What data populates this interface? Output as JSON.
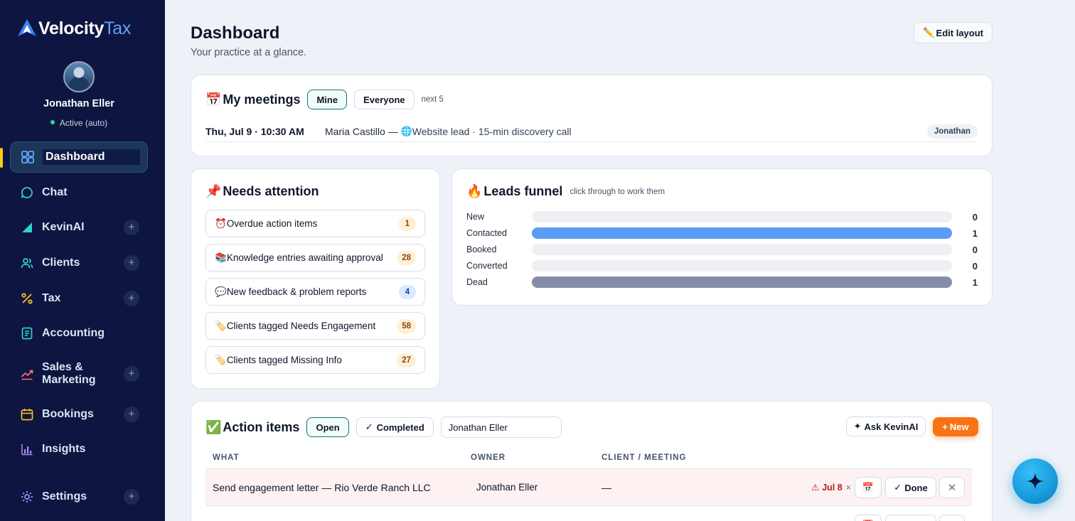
{
  "brand": {
    "name_a": "Velocity",
    "name_b": "Tax"
  },
  "user": {
    "name": "Jonathan Eller",
    "status": "Active (auto)"
  },
  "nav": [
    {
      "label": "Dashboard",
      "icon": "grid-icon",
      "plus": false,
      "active": true
    },
    {
      "label": "Chat",
      "icon": "chat-icon",
      "plus": false
    },
    {
      "label": "KevinAI",
      "icon": "kevinai-icon",
      "plus": true
    },
    {
      "label": "Clients",
      "icon": "users-icon",
      "plus": true
    },
    {
      "label": "Tax",
      "icon": "percent-icon",
      "plus": true
    },
    {
      "label": "Accounting",
      "icon": "ledger-icon",
      "plus": false
    },
    {
      "label": "Sales &\nMarketing",
      "icon": "trending-icon",
      "plus": true
    },
    {
      "label": "Bookings",
      "icon": "calendar-icon",
      "plus": true
    },
    {
      "label": "Insights",
      "icon": "bar-chart-icon",
      "plus": false
    },
    {
      "label": "Settings",
      "icon": "settings-icon",
      "plus": true
    }
  ],
  "page": {
    "title": "Dashboard",
    "subtitle": "Your practice at a glance.",
    "edit_label": "Edit layout"
  },
  "meetings": {
    "title": "My meetings",
    "tab_mine": "Mine",
    "tab_everyone": "Everyone",
    "hint": "next 5",
    "rows": [
      {
        "when": "Thu, Jul 9 · 10:30 AM",
        "who": "Maria Castillo — ",
        "source": "Website lead · 15-min discovery call",
        "owner": "Jonathan"
      }
    ]
  },
  "attention": {
    "title": "Needs attention",
    "items": [
      {
        "emoji": "⏰",
        "label": "Overdue action items",
        "count": "1",
        "tone": "amber"
      },
      {
        "emoji": "📚",
        "label": "Knowledge entries awaiting approval",
        "count": "28",
        "tone": "amber"
      },
      {
        "emoji": "💬",
        "label": "New feedback & problem reports",
        "count": "4",
        "tone": "blue"
      },
      {
        "emoji": "🏷️",
        "label": "Clients tagged Needs Engagement",
        "count": "58",
        "tone": "amber"
      },
      {
        "emoji": "🏷️",
        "label": "Clients tagged Missing Info",
        "count": "27",
        "tone": "amber"
      }
    ]
  },
  "funnel": {
    "title": "Leads funnel",
    "hint": "click through to work them",
    "stages": [
      {
        "label": "New",
        "value": 0,
        "fraction": 0,
        "color": "#5b9cf6"
      },
      {
        "label": "Contacted",
        "value": 1,
        "fraction": 1,
        "color": "#5b9cf6"
      },
      {
        "label": "Booked",
        "value": 0,
        "fraction": 0,
        "color": "#5b9cf6"
      },
      {
        "label": "Converted",
        "value": 0,
        "fraction": 0,
        "color": "#5b9cf6"
      },
      {
        "label": "Dead",
        "value": 1,
        "fraction": 1,
        "color": "#868da8"
      }
    ]
  },
  "actions": {
    "title": "Action items",
    "tab_open": "Open",
    "tab_completed": "Completed",
    "owner_filter": "Jonathan Eller",
    "ask_label": "Ask KevinAI",
    "new_label": "New",
    "columns": [
      "WHAT",
      "OWNER",
      "CLIENT / MEETING"
    ],
    "rows": [
      {
        "what": "Send engagement letter — Rio Verde Ranch LLC",
        "owner": "Jonathan Eller",
        "client": "—",
        "due": "Jul 8",
        "done_label": "Done"
      }
    ]
  },
  "colors": {
    "accent": "#0f766e",
    "new_button": "#f97316",
    "danger": "#b91c1c",
    "sidebar": "#0d1540"
  }
}
